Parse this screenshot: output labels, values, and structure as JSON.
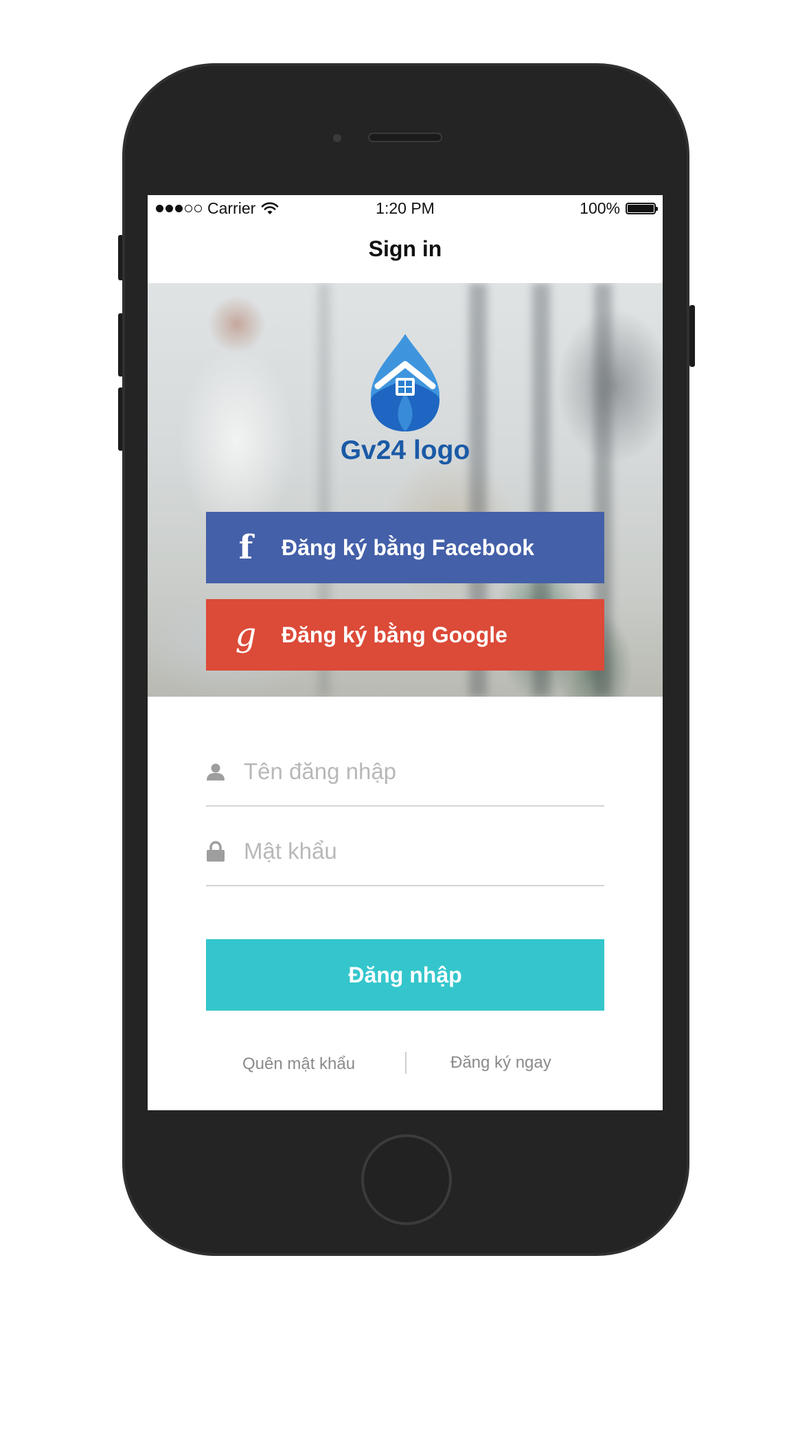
{
  "status_bar": {
    "carrier": "Carrier",
    "time": "1:20 PM",
    "battery": "100%"
  },
  "nav": {
    "title": "Sign in"
  },
  "hero": {
    "logo_text": "Gv24 logo"
  },
  "social": {
    "facebook_label": "Đăng ký bằng Facebook",
    "facebook_icon": "f",
    "google_label": "Đăng ký bằng Google",
    "google_icon": "g"
  },
  "form": {
    "username_placeholder": "Tên đăng nhập",
    "username_value": "",
    "password_placeholder": "Mật khẩu",
    "password_value": "",
    "login_label": "Đăng nhập"
  },
  "links": {
    "forgot_password": "Quên mật khẩu",
    "register_now": "Đăng ký ngay"
  },
  "colors": {
    "facebook": "#4460a8",
    "google": "#dc4a38",
    "login": "#34c6cc",
    "logo": "#1b5aa6"
  },
  "icons": [
    "user-icon",
    "lock-icon",
    "facebook-icon",
    "google-icon",
    "wifi-icon",
    "battery-icon",
    "signal-icon"
  ]
}
